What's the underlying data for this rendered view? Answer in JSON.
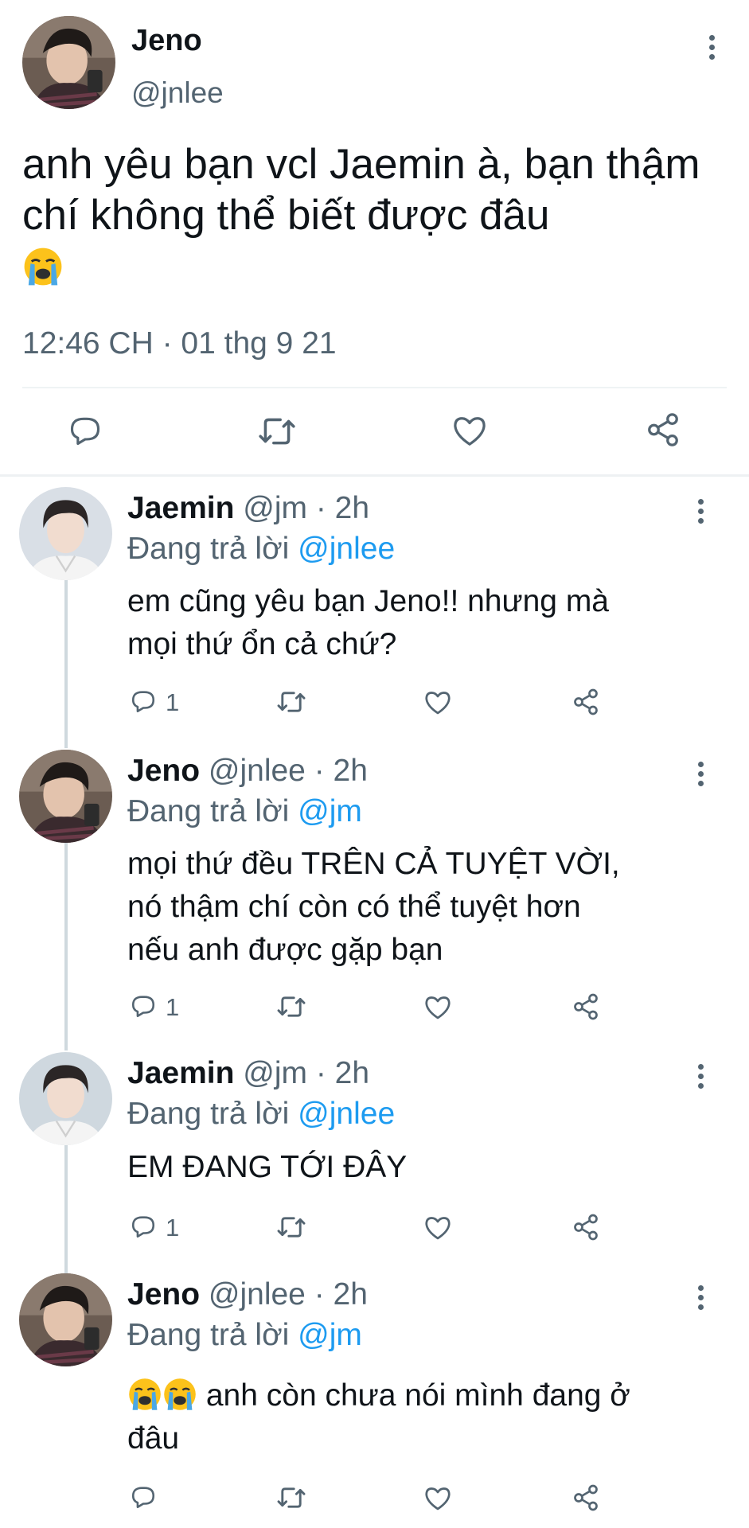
{
  "main_tweet": {
    "author_name": "Jeno",
    "handle": "@jnlee",
    "text": "anh yêu bạn vcl Jaemin à, bạn thậm chí không thể biết được đâu",
    "timestamp": "12:46 CH · 01 thg 9 21",
    "avatar_icon": "avatar-jeno",
    "emoji": "loudly-crying-face"
  },
  "actions": {
    "reply_icon": "reply-icon",
    "retweet_icon": "retweet-icon",
    "like_icon": "like-icon",
    "share_icon": "share-icon"
  },
  "replies": [
    {
      "name": "Jaemin",
      "meta": "@jm · 2h",
      "replying_prefix": "Đang trả lời",
      "replying_to": "@jnlee",
      "text_lines": [
        "em cũng yêu bạn Jeno!! nhưng mà",
        "mọi thứ ổn cả chứ?"
      ],
      "reply_count": "1",
      "avatar_icon": "avatar-jaemin"
    },
    {
      "name": "Jeno",
      "meta": "@jnlee · 2h",
      "replying_prefix": "Đang trả lời",
      "replying_to": "@jm",
      "text_lines": [
        "mọi thứ đều TRÊN CẢ TUYỆT VỜI,",
        "nó thậm chí còn có thể tuyệt hơn",
        "nếu anh được gặp bạn"
      ],
      "reply_count": "1",
      "avatar_icon": "avatar-jeno"
    },
    {
      "name": "Jaemin",
      "meta": "@jm · 2h",
      "replying_prefix": "Đang trả lời",
      "replying_to": "@jnlee",
      "text_lines": [
        "EM ĐANG TỚI ĐÂY"
      ],
      "reply_count": "1",
      "avatar_icon": "avatar-jaemin"
    },
    {
      "name": "Jeno",
      "meta": "@jnlee · 2h",
      "replying_prefix": "Đang trả lời",
      "replying_to": "@jm",
      "text_lines": [
        "anh còn chưa nói mình đang ở",
        "đâu"
      ],
      "reply_count": "",
      "avatar_icon": "avatar-jeno"
    }
  ],
  "colors": {
    "text": "#0f1419",
    "secondary": "#536471",
    "mention": "#1d9bf0",
    "divider": "#eff3f4",
    "thread_line": "#cfd9de"
  }
}
